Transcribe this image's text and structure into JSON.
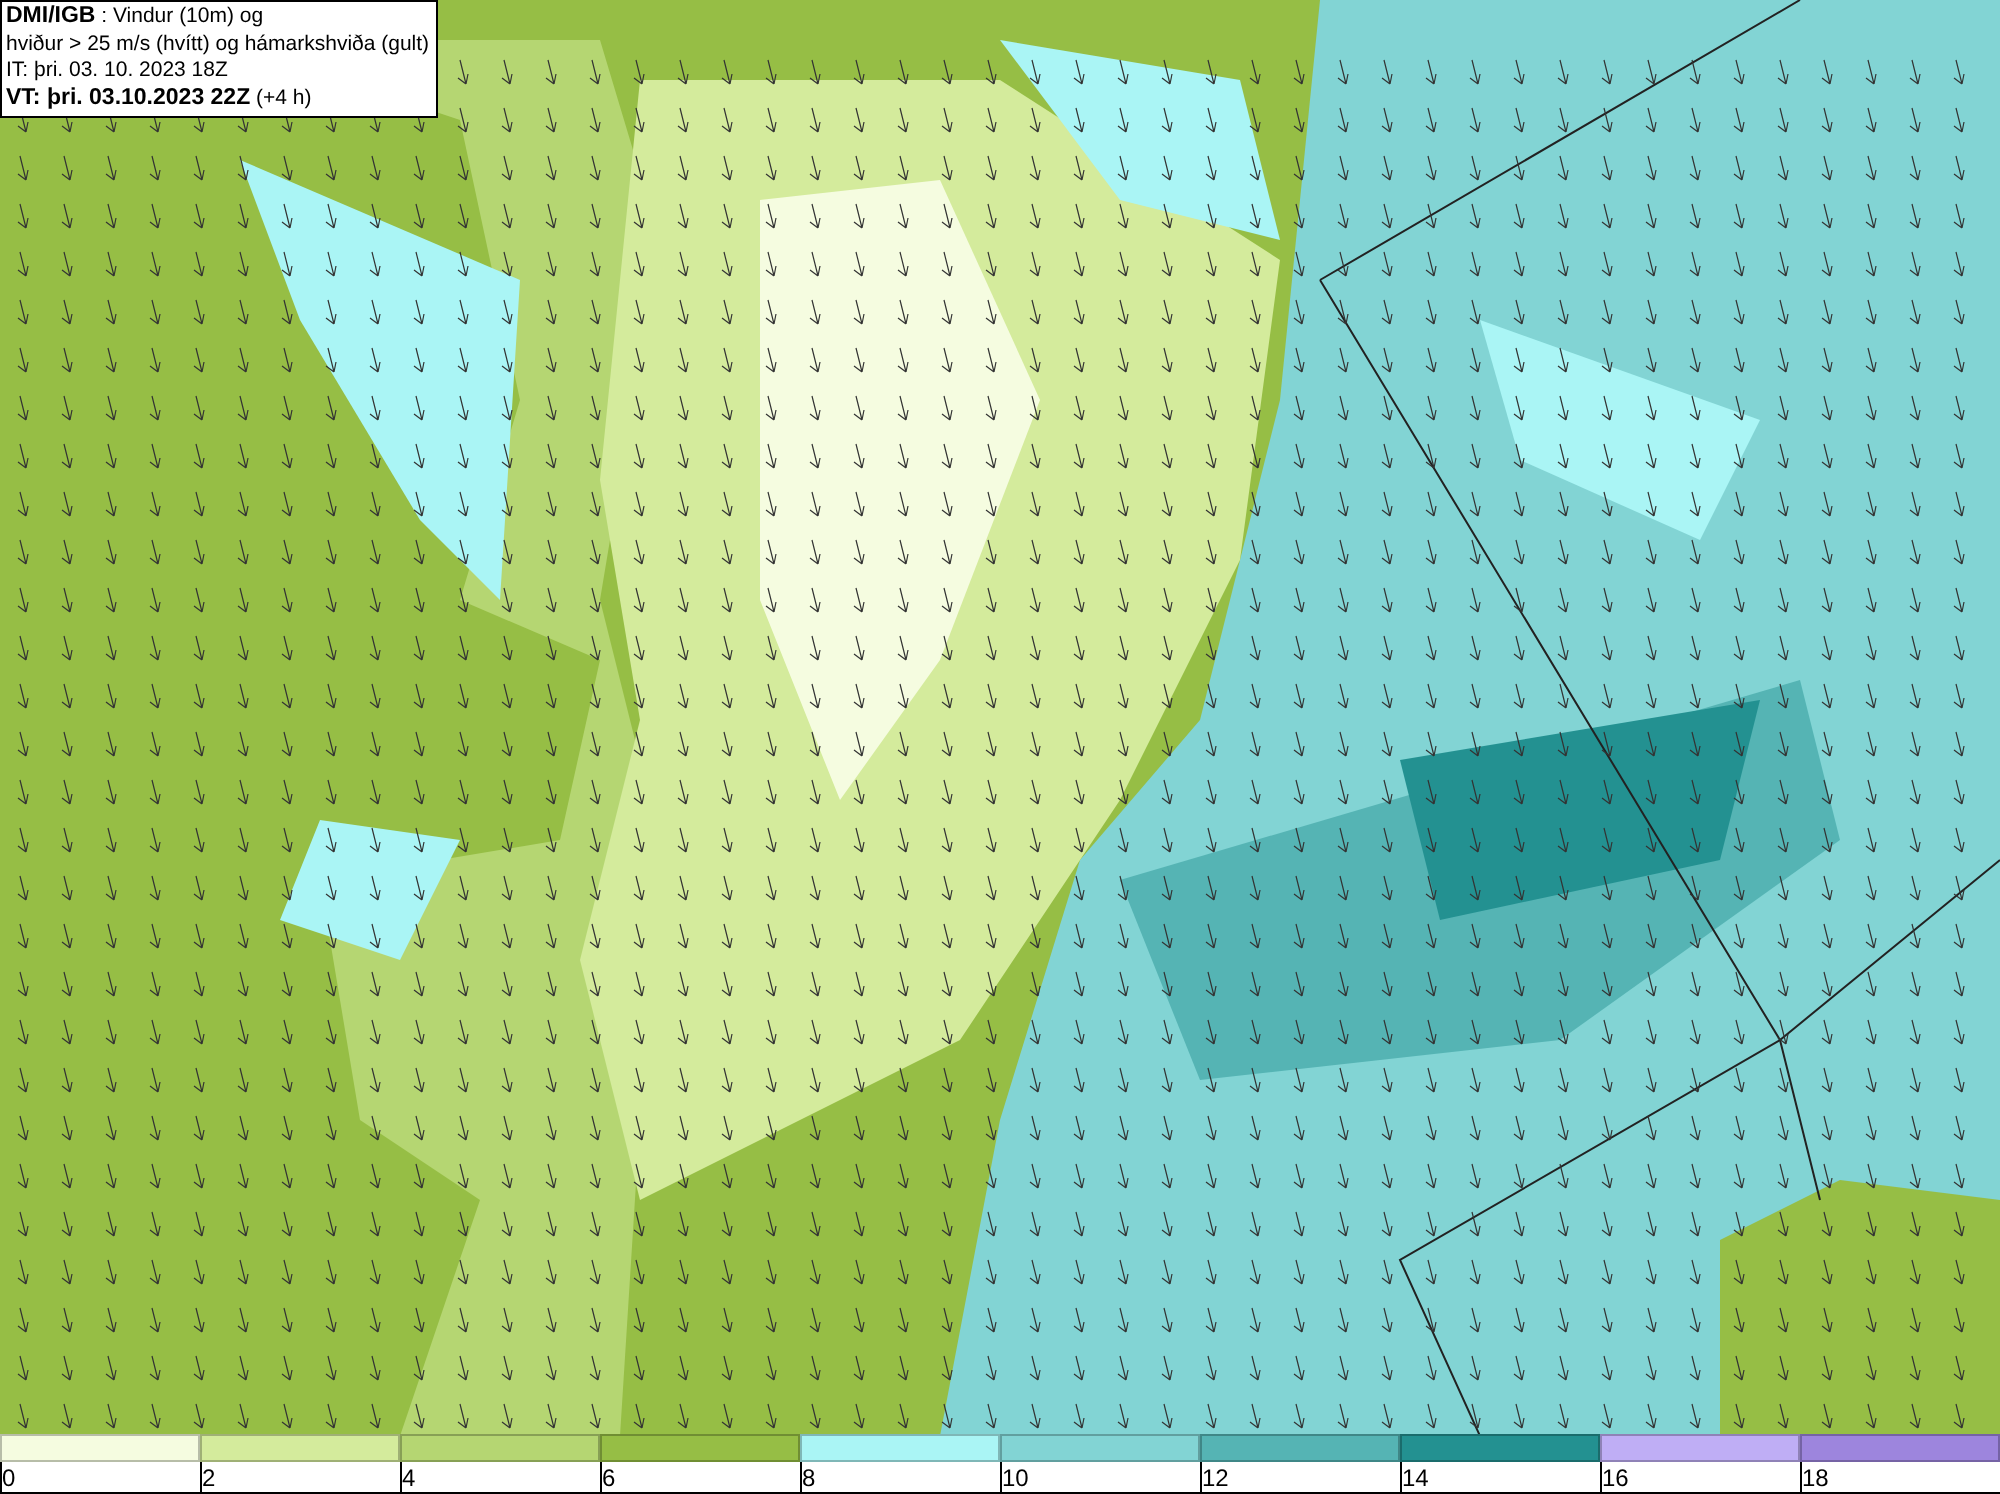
{
  "header": {
    "lines": [
      "**DMI/IGB** : Vindur (10m) og",
      "hviður > 25 m/s (hvítt) og hámarkshviða (gult)",
      "IT: þri. 03. 10. 2023 18Z",
      "**VT: þri. 03.10.2023 22Z** (+4 h)"
    ]
  },
  "legend": [
    {
      "label": "0",
      "color": "#f5fce0"
    },
    {
      "label": "2",
      "color": "#d4eb9c"
    },
    {
      "label": "4",
      "color": "#b5d672"
    },
    {
      "label": "6",
      "color": "#96be45"
    },
    {
      "label": "8",
      "color": "#aaf5f5"
    },
    {
      "label": "10",
      "color": "#82d4d4"
    },
    {
      "label": "12",
      "color": "#55b4b4"
    },
    {
      "label": "14",
      "color": "#239191"
    },
    {
      "label": "16",
      "color": "#bfaef5"
    },
    {
      "label": "18",
      "color": "#9d85dd"
    }
  ]
}
